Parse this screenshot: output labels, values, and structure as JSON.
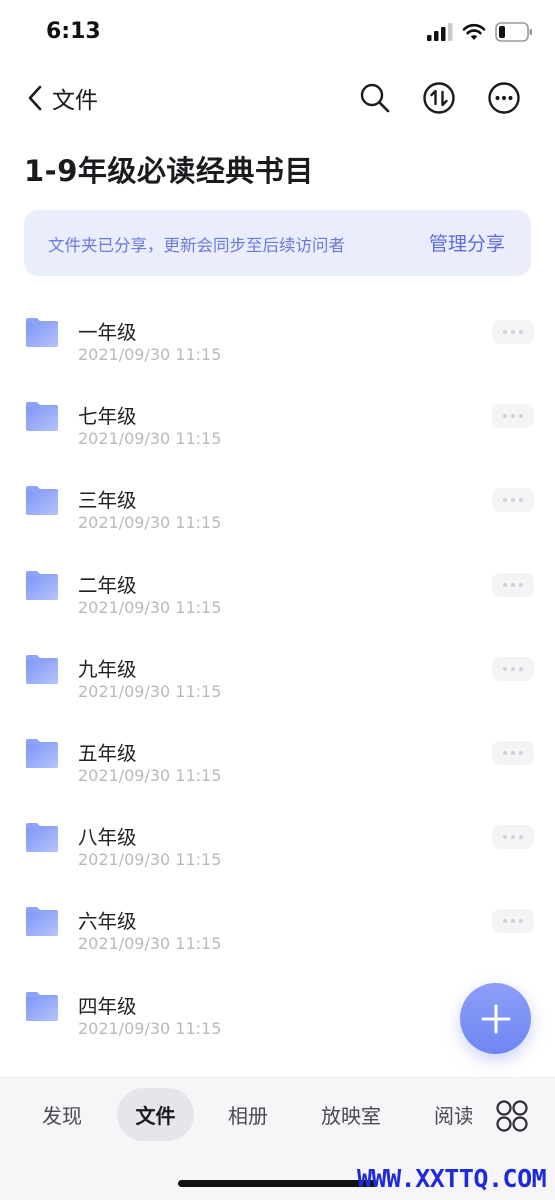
{
  "status_bar": {
    "time": "6:13"
  },
  "nav": {
    "back_label": "文件"
  },
  "page": {
    "title": "1-9年级必读经典书目"
  },
  "share_banner": {
    "text": "文件夹已分享，更新会同步至后续访问者",
    "action_label": "管理分享"
  },
  "files": [
    {
      "name": "一年级",
      "date": "2021/09/30 11:15"
    },
    {
      "name": "七年级",
      "date": "2021/09/30 11:15"
    },
    {
      "name": "三年级",
      "date": "2021/09/30 11:15"
    },
    {
      "name": "二年级",
      "date": "2021/09/30 11:15"
    },
    {
      "name": "九年级",
      "date": "2021/09/30 11:15"
    },
    {
      "name": "五年级",
      "date": "2021/09/30 11:15"
    },
    {
      "name": "八年级",
      "date": "2021/09/30 11:15"
    },
    {
      "name": "六年级",
      "date": "2021/09/30 11:15"
    },
    {
      "name": "四年级",
      "date": "2021/09/30 11:15"
    }
  ],
  "tabs": [
    {
      "label": "发现",
      "active": false
    },
    {
      "label": "文件",
      "active": true
    },
    {
      "label": "相册",
      "active": false
    },
    {
      "label": "放映室",
      "active": false
    },
    {
      "label": "阅读",
      "active": false
    }
  ],
  "colors": {
    "accent": "#6f86f2",
    "banner_bg": "#e9edfc",
    "banner_text": "#6c7ad8"
  },
  "icons": [
    "back-icon",
    "search-icon",
    "sort-icon",
    "more-icon",
    "folder-icon",
    "plus-icon",
    "grid-icon"
  ],
  "watermark": "WWW.XXTTQ.COM"
}
